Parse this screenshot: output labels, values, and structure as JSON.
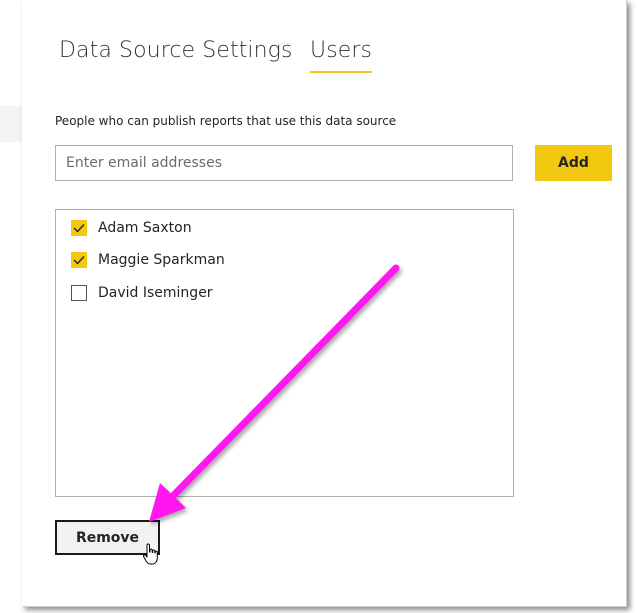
{
  "tabs": [
    {
      "label": "Data Source Settings",
      "active": false
    },
    {
      "label": "Users",
      "active": true
    }
  ],
  "description": "People who can publish reports that use this data source",
  "email_input": {
    "value": "",
    "placeholder": "Enter email addresses"
  },
  "add_button": {
    "label": "Add"
  },
  "users": [
    {
      "name": "Adam Saxton",
      "checked": true
    },
    {
      "name": "Maggie Sparkman",
      "checked": true
    },
    {
      "name": "David Iseminger",
      "checked": false
    }
  ],
  "remove_button": {
    "label": "Remove"
  },
  "colors": {
    "accent": "#f2c811",
    "annotation_arrow": "#ff14f0",
    "text": "#252423",
    "border": "#b0b0b0"
  },
  "icons": {
    "checkbox_checked": "check-icon",
    "cursor": "hand-pointer-icon",
    "annotation": "arrow-annotation"
  }
}
